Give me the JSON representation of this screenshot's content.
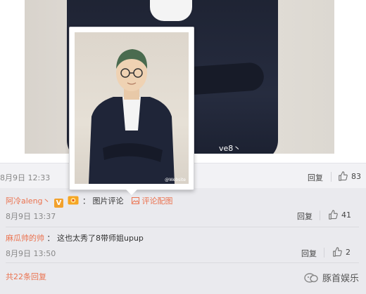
{
  "post": {
    "photo_watermark": "ve8丶",
    "time": "8月9日 12:33",
    "reply_label": "回复",
    "like_count": "83"
  },
  "popup": {
    "caption": "@Website"
  },
  "comments": [
    {
      "user": "阿冷aleng丶",
      "badge_v": "V",
      "separator": "：",
      "text": "图片评论",
      "image_link": "评论配图",
      "time": "8月9日 13:37",
      "reply_label": "回复",
      "like_count": "41"
    },
    {
      "user": "麻瓜帅的帅",
      "separator": "：",
      "text": "这也太秀了8带师姐upup",
      "time": "8月9日 13:50",
      "reply_label": "回复",
      "like_count": "2"
    }
  ],
  "footer": {
    "more_replies": "共22条回复",
    "brand": "豚首娱乐"
  },
  "colors": {
    "accent": "#eb7350",
    "badge_v": "#f2a12c",
    "background": "#eaeaee"
  },
  "icons": [
    "thumb-up-icon",
    "image-icon",
    "vip-v-icon",
    "fan-badge-icon",
    "brand-logo-icon"
  ]
}
